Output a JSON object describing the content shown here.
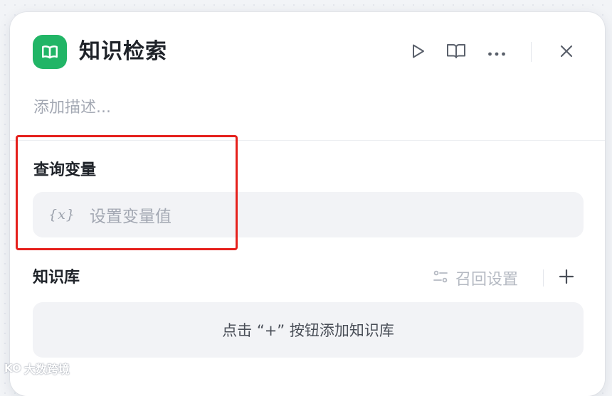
{
  "node": {
    "title": "知识检索",
    "description_placeholder": "添加描述...",
    "icon": "book-open-icon",
    "accent_color": "#21b566"
  },
  "header_actions": {
    "run_icon": "play-icon",
    "docs_icon": "book-icon",
    "more_icon": "more-horizontal-icon",
    "close_icon": "close-icon"
  },
  "query_variable": {
    "label": "查询变量",
    "icon_text": "{x}",
    "placeholder": "设置变量值",
    "highlight_color": "#e5201c"
  },
  "knowledge_base": {
    "label": "知识库",
    "recall_settings_label": "召回设置",
    "add_icon": "plus-icon",
    "empty_hint": "点击 “+” 按钮添加知识库"
  },
  "watermark": {
    "logo_text": "KO",
    "text": "大数跨境"
  }
}
